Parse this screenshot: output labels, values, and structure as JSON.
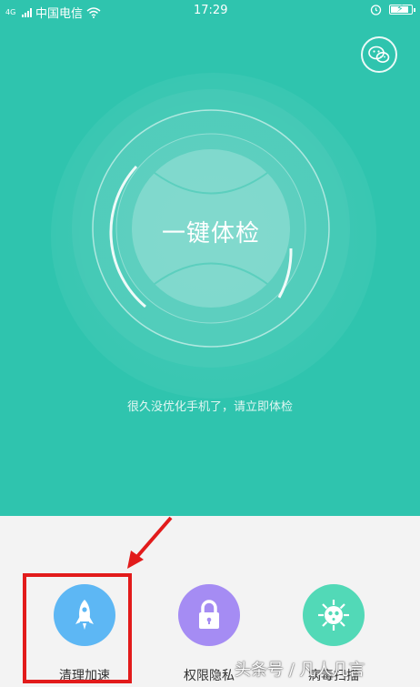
{
  "status_bar": {
    "network_type": "4G",
    "carrier": "中国电信",
    "time": "17:29"
  },
  "main": {
    "checkup_label": "一键体检",
    "hint": "很久没优化手机了，请立即体检"
  },
  "tools": [
    {
      "label": "清理加速",
      "icon": "rocket-icon",
      "color": "#5db7f4"
    },
    {
      "label": "权限隐私",
      "icon": "lock-icon",
      "color": "#a58cf3"
    },
    {
      "label": "病毒扫描",
      "icon": "virus-icon",
      "color": "#52d9b7"
    }
  ],
  "watermark": "头条号 / 凡人几言",
  "colors": {
    "accent": "#2fc4ae",
    "annotation": "#e21b1b"
  }
}
